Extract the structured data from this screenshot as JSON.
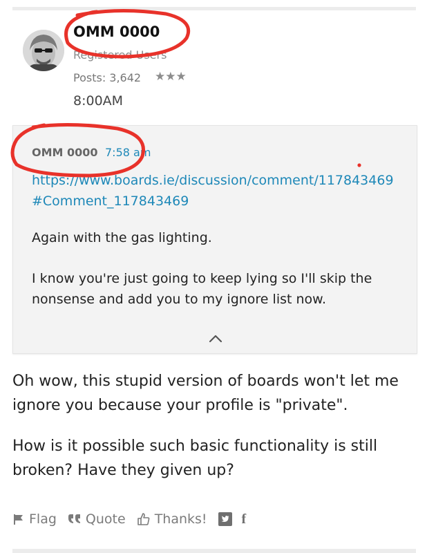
{
  "post": {
    "author": "OMM 0000",
    "role": "Registered Users",
    "posts": "Posts: 3,642",
    "rank_stars": "★★★",
    "time": "8:00AM"
  },
  "quote": {
    "author": "OMM 0000",
    "time": "7:58 am",
    "link": "https://www.boards.ie/discussion/comment/117843469#Comment_117843469",
    "line1": "Again with the gas lighting.",
    "line2": "I know you're just going to keep lying so I'll skip the nonsense and add you to my ignore list now."
  },
  "body": {
    "paragraph1": "Oh wow, this stupid version of boards won't let me ignore you because your profile is \"private\".",
    "paragraph2": "How is it possible such basic functionality is still broken? Have they given up?"
  },
  "actions": {
    "flag": "Flag",
    "quote": "Quote",
    "thanks": "Thanks!",
    "facebook": "f"
  },
  "colors": {
    "link": "#1e88b8",
    "annotation": "#e8322a",
    "quote_bg": "#f3f3f3"
  }
}
